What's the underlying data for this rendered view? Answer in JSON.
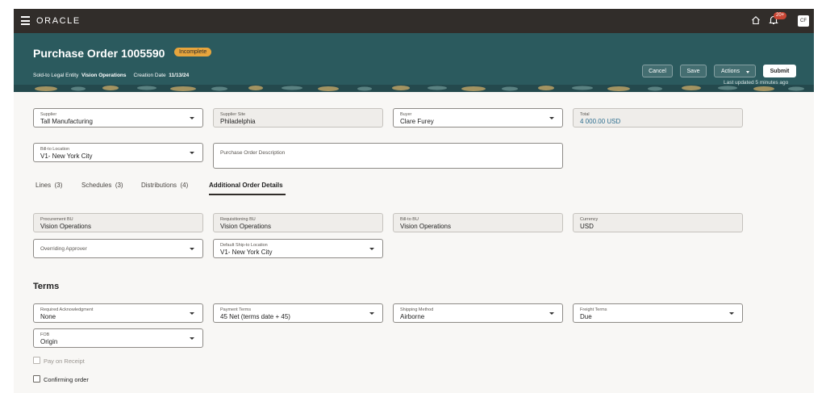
{
  "topbar": {
    "logo": "ORACLE",
    "notification_count": "20+",
    "user_initials": "CF"
  },
  "header": {
    "title": "Purchase Order 1005590",
    "status": "Incomplete",
    "legal_entity_label": "Sold-to Legal Entity",
    "legal_entity_value": "Vision Operations",
    "creation_date_label": "Creation Date",
    "creation_date_value": "11/13/24",
    "buttons": {
      "cancel": "Cancel",
      "save": "Save",
      "actions": "Actions",
      "submit": "Submit"
    },
    "last_updated": "Last updated 5 minutes ago"
  },
  "main_fields": {
    "supplier": {
      "label": "Supplier",
      "value": "Tall Manufacturing"
    },
    "supplier_site": {
      "label": "Supplier Site",
      "value": "Philadelphia"
    },
    "buyer": {
      "label": "Buyer",
      "value": "Clare Furey"
    },
    "total": {
      "label": "Total",
      "value": "4 000.00 USD"
    },
    "bill_to_location": {
      "label": "Bill-to Location",
      "value": "V1- New York City"
    },
    "po_description": {
      "label": "Purchase Order Description"
    }
  },
  "tabs": [
    {
      "label": "Lines",
      "count": "(3)"
    },
    {
      "label": "Schedules",
      "count": "(3)"
    },
    {
      "label": "Distributions",
      "count": "(4)"
    },
    {
      "label": "Additional Order Details",
      "count": ""
    }
  ],
  "additional": {
    "procurement_bu": {
      "label": "Procurement BU",
      "value": "Vision Operations"
    },
    "requisitioning_bu": {
      "label": "Requisitioning BU",
      "value": "Vision Operations"
    },
    "bill_to_bu": {
      "label": "Bill-to BU",
      "value": "Vision Operations"
    },
    "currency": {
      "label": "Currency",
      "value": "USD"
    },
    "overriding_approver": {
      "label": "Overriding Approver"
    },
    "default_ship_to": {
      "label": "Default Ship-to Location",
      "value": "V1- New York City"
    }
  },
  "terms": {
    "title": "Terms",
    "required_ack": {
      "label": "Required Acknowledgment",
      "value": "None"
    },
    "payment_terms": {
      "label": "Payment Terms",
      "value": "45 Net (terms date + 45)"
    },
    "shipping_method": {
      "label": "Shipping Method",
      "value": "Airborne"
    },
    "freight_terms": {
      "label": "Freight Terms",
      "value": "Due"
    },
    "fob": {
      "label": "FOB",
      "value": "Origin"
    },
    "pay_on_receipt": "Pay on Receipt",
    "confirming_order": "Confirming order"
  },
  "colors": {
    "topbar": "#312d2a",
    "header": "#2b5a5e",
    "badge": "#e7a53d",
    "link": "#2d6e8f"
  }
}
